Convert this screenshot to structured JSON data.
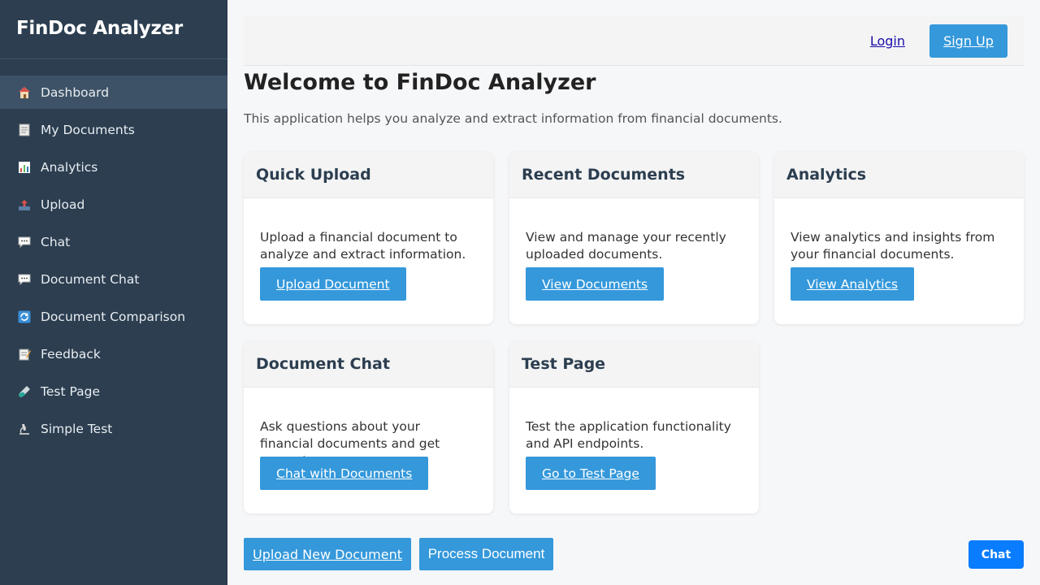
{
  "app": {
    "title": "FinDoc Analyzer"
  },
  "sidebar": {
    "items": [
      {
        "label": "Dashboard",
        "icon": "home-icon",
        "active": true
      },
      {
        "label": "My Documents",
        "icon": "document-icon"
      },
      {
        "label": "Analytics",
        "icon": "bar-chart-icon"
      },
      {
        "label": "Upload",
        "icon": "upload-tray-icon"
      },
      {
        "label": "Chat",
        "icon": "speech-bubble-icon"
      },
      {
        "label": "Document Chat",
        "icon": "speech-bubble-icon"
      },
      {
        "label": "Document Comparison",
        "icon": "refresh-arrows-icon"
      },
      {
        "label": "Feedback",
        "icon": "memo-icon"
      },
      {
        "label": "Test Page",
        "icon": "test-tube-icon"
      },
      {
        "label": "Simple Test",
        "icon": "microscope-icon"
      }
    ]
  },
  "header": {
    "login": "Login",
    "signup": "Sign Up"
  },
  "main": {
    "title": "Welcome to FinDoc Analyzer",
    "description": "This application helps you analyze and extract information from financial documents.",
    "cards": [
      {
        "title": "Quick Upload",
        "text": "Upload a financial document to analyze and extract information.",
        "button": "Upload Document"
      },
      {
        "title": "Recent Documents",
        "text": "View and manage your recently uploaded documents.",
        "button": "View Documents"
      },
      {
        "title": "Analytics",
        "text": "View analytics and insights from your financial documents.",
        "button": "View Analytics"
      },
      {
        "title": "Document Chat",
        "text": "Ask questions about your financial documents and get accurate answers.",
        "button": "Chat with Documents"
      },
      {
        "title": "Test Page",
        "text": "Test the application functionality and API endpoints.",
        "button": "Go to Test Page"
      }
    ],
    "bottom": {
      "upload_new": "Upload New Document",
      "process": "Process Document"
    },
    "chat_button": "Chat"
  },
  "colors": {
    "sidebar": "#2c3e50",
    "accent": "#3498db",
    "chat": "#0a7cff"
  }
}
